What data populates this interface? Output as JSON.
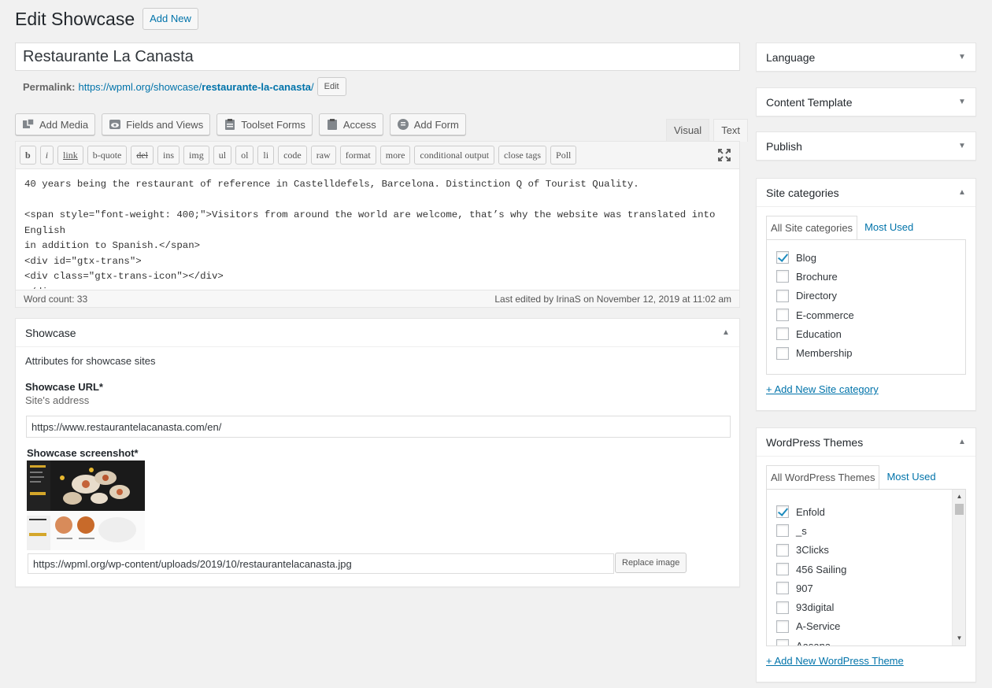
{
  "header": {
    "title": "Edit Showcase",
    "add_new": "Add New"
  },
  "post_title": "Restaurante La Canasta",
  "permalink": {
    "label": "Permalink:",
    "base": "https://wpml.org/showcase/",
    "slug": "restaurante-la-canasta",
    "trail": "/",
    "edit": "Edit"
  },
  "media_buttons": [
    {
      "label": "Add Media",
      "icon": "media-icon"
    },
    {
      "label": "Fields and Views",
      "icon": "eye-icon"
    },
    {
      "label": "Toolset Forms",
      "icon": "clipboard-icon"
    },
    {
      "label": "Access",
      "icon": "lock-icon"
    },
    {
      "label": "Add Form",
      "icon": "form-icon"
    }
  ],
  "editor_tabs": {
    "visual": "Visual",
    "text": "Text"
  },
  "quicktags": [
    "b",
    "i",
    "link",
    "b-quote",
    "del",
    "ins",
    "img",
    "ul",
    "ol",
    "li",
    "code",
    "raw",
    "format",
    "more",
    "conditional output",
    "close tags",
    "Poll"
  ],
  "content": "40 years being the restaurant of reference in Castelldefels, Barcelona. Distinction Q of Tourist Quality.\n\n<span style=\"font-weight: 400;\">Visitors from around the world are welcome, that’s why the website was translated into English\nin addition to Spanish.</span>\n<div id=\"gtx-trans\">\n<div class=\"gtx-trans-icon\"></div>\n</div>",
  "status": {
    "word_count": "Word count: 33",
    "last_edited": "Last edited by IrinaS on November 12, 2019 at 11:02 am"
  },
  "showcase": {
    "title": "Showcase",
    "intro": "Attributes for showcase sites",
    "url_label": "Showcase URL*",
    "url_desc": "Site's address",
    "url_value": "https://www.restaurantelacanasta.com/en/",
    "screenshot_label": "Showcase screenshot*",
    "image_value": "https://wpml.org/wp-content/uploads/2019/10/restaurantelacanasta.jpg",
    "replace_label": "Replace image"
  },
  "sidebar": {
    "language": "Language",
    "content_template": "Content Template",
    "publish": "Publish",
    "site_categories": {
      "title": "Site categories",
      "tab_all": "All Site categories",
      "tab_used": "Most Used",
      "items": [
        {
          "label": "Blog",
          "checked": true
        },
        {
          "label": "Brochure",
          "checked": false
        },
        {
          "label": "Directory",
          "checked": false
        },
        {
          "label": "E-commerce",
          "checked": false
        },
        {
          "label": "Education",
          "checked": false
        },
        {
          "label": "Membership",
          "checked": false
        }
      ],
      "add_new": "+ Add New Site category"
    },
    "themes": {
      "title": "WordPress Themes",
      "tab_all": "All WordPress Themes",
      "tab_used": "Most Used",
      "items": [
        {
          "label": "Enfold",
          "checked": true
        },
        {
          "label": "_s",
          "checked": false
        },
        {
          "label": "3Clicks",
          "checked": false
        },
        {
          "label": "456 Sailing",
          "checked": false
        },
        {
          "label": "907",
          "checked": false
        },
        {
          "label": "93digital",
          "checked": false
        },
        {
          "label": "A-Service",
          "checked": false
        },
        {
          "label": "Aasana",
          "checked": false
        }
      ],
      "add_new": "+ Add New WordPress Theme"
    }
  }
}
